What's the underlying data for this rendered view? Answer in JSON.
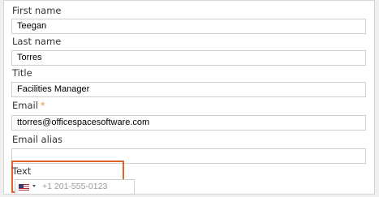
{
  "form": {
    "first_name": {
      "label": "First name",
      "value": "Teegan"
    },
    "last_name": {
      "label": "Last name",
      "value": "Torres"
    },
    "title": {
      "label": "Title",
      "value": "Facilities Manager"
    },
    "email": {
      "label": "Email",
      "required_mark": "*",
      "value": "ttorres@officespacesoftware.com"
    },
    "email_alias": {
      "label": "Email alias",
      "value": ""
    },
    "text": {
      "label": "Text",
      "country_icon": "us-flag-icon",
      "placeholder": "+1 201-555-0123"
    }
  },
  "colors": {
    "highlight": "#e0622c",
    "required": "#e89a2c"
  }
}
